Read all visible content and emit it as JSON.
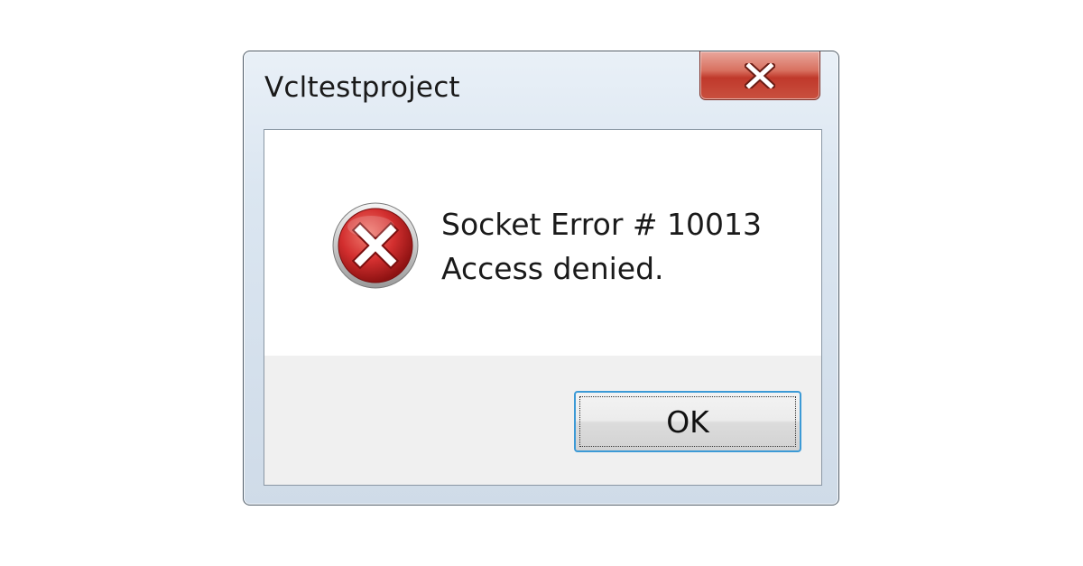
{
  "window": {
    "title": "Vcltestproject",
    "close_icon": "close-x-icon"
  },
  "message": {
    "icon": "error-icon",
    "line1": "Socket Error # 10013",
    "line2": "Access denied."
  },
  "buttons": {
    "ok_label": "OK"
  },
  "colors": {
    "close_button": "#c0392b",
    "error_icon": "#c62828",
    "focus_border": "#3c9ad6",
    "button_area": "#f0f0f0"
  }
}
